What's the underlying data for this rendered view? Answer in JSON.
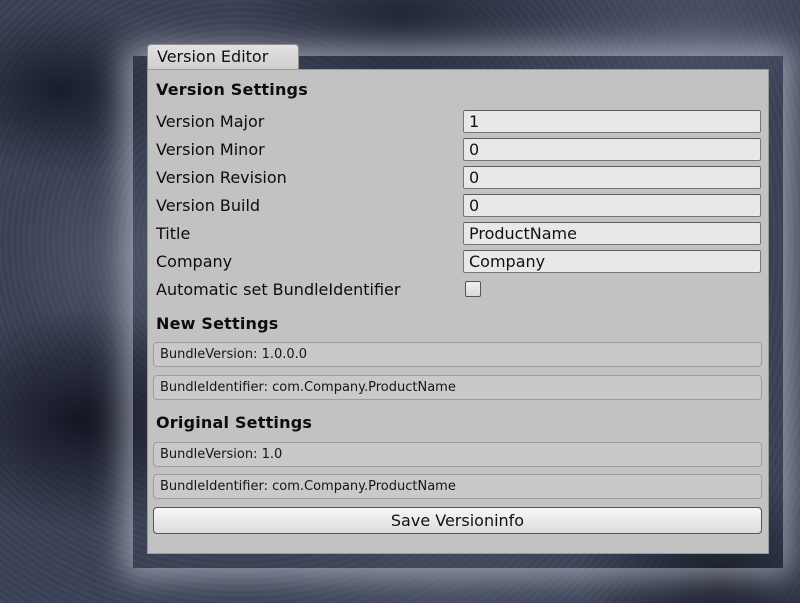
{
  "window": {
    "tab_title": "Version Editor"
  },
  "version_settings": {
    "heading": "Version Settings",
    "fields": [
      {
        "label": "Version Major",
        "value": "1"
      },
      {
        "label": "Version Minor",
        "value": "0"
      },
      {
        "label": "Version Revision",
        "value": "0"
      },
      {
        "label": "Version Build",
        "value": "0"
      },
      {
        "label": "Title",
        "value": "ProductName"
      },
      {
        "label": "Company",
        "value": "Company"
      }
    ],
    "auto_bundle": {
      "label": "Automatic set BundleIdentifier",
      "checked": false
    }
  },
  "new_settings": {
    "heading": "New Settings",
    "bundle_version": "BundleVersion: 1.0.0.0",
    "bundle_identifier": "BundleIdentifier: com.Company.ProductName"
  },
  "original_settings": {
    "heading": "Original Settings",
    "bundle_version": "BundleVersion: 1.0",
    "bundle_identifier": "BundleIdentifier: com.Company.ProductName"
  },
  "actions": {
    "save_label": "Save Versioninfo"
  }
}
